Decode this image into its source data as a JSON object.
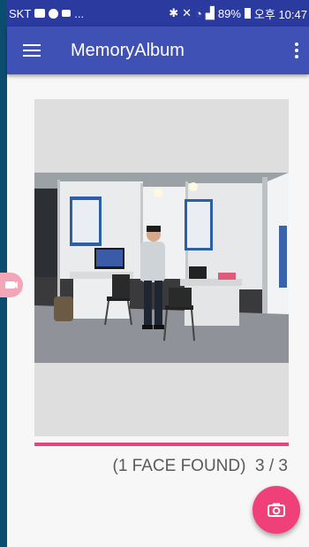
{
  "colors": {
    "status_bar": "#2b3a9e",
    "app_bar": "#3f51b5",
    "accent": "#e8437c",
    "fab": "#f0407a"
  },
  "status_bar": {
    "carrier": "SKT",
    "notif_more": "...",
    "battery": "89%",
    "time": "오후 10:47",
    "icons": [
      "gallery-icon",
      "chat-icon",
      "video-icon",
      "bluetooth-icon",
      "mute-icon",
      "wifi-icon",
      "signal-icon",
      "battery-icon"
    ]
  },
  "app_bar": {
    "title": "MemoryAlbum",
    "nav_icon": "menu-icon",
    "overflow_icon": "more-vert-icon"
  },
  "viewer": {
    "image_description_icon": "photo-exhibition-booth",
    "progress": 1.0
  },
  "counter": {
    "faces": "(1 FACE FOUND)",
    "position": "3 / 3"
  },
  "fab": {
    "icon": "camera-icon"
  },
  "side_badge": {
    "icon": "camera-switch-icon"
  }
}
